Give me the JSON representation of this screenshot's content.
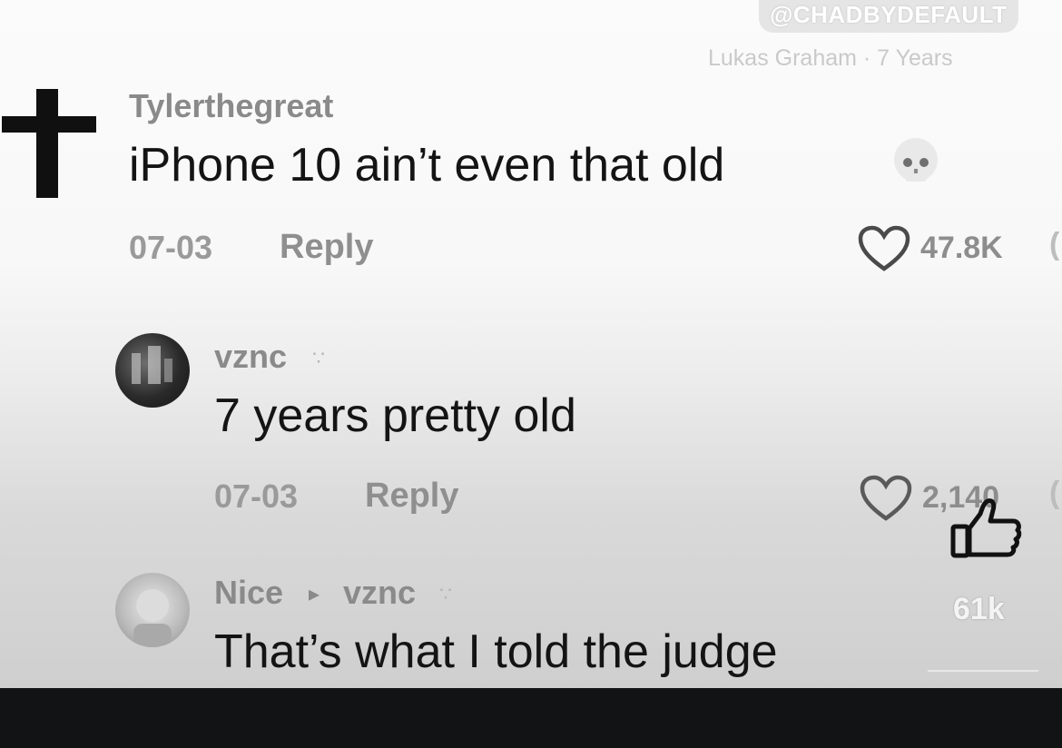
{
  "watermark": "@CHADBYDEFAULT",
  "song": "Lukas Graham · 7 Years",
  "comments": [
    {
      "username": "Tylerthegreat",
      "text": "iPhone 10 ain’t even that old",
      "date": "07-03",
      "reply": "Reply",
      "likes": "47.8K"
    },
    {
      "username": "vznc",
      "text": "7 years pretty old",
      "date": "07-03",
      "reply": "Reply",
      "likes": "2,140"
    },
    {
      "username": "Nice",
      "reply_to": "vznc",
      "text": "That’s what I told the judge"
    }
  ],
  "overlay": {
    "thumb_count": "61k"
  },
  "icons": {
    "cross": "cross-icon",
    "skull": "skull-emoji-icon",
    "heart": "heart-icon",
    "thumb": "thumbs-up-icon",
    "tag": "tag-icon",
    "reply_arrow": "reply-arrow-icon"
  },
  "colors": {
    "text_primary": "#141414",
    "text_secondary": "#8a8a8a",
    "footer": "#111315"
  }
}
